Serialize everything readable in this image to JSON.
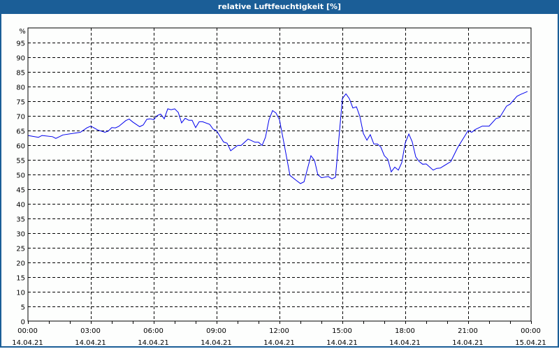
{
  "window": {
    "title": "relative Luftfeuchtigkeit [%]"
  },
  "colors": {
    "titlebar": "#1b5e97",
    "line": "#0000ee",
    "grid": "#000000"
  },
  "chart_data": {
    "type": "line",
    "title": "relative Luftfeuchtigkeit [%]",
    "ylabel": "%",
    "xlabel": "",
    "ylim": [
      0,
      100
    ],
    "xlim_hours": [
      0,
      24
    ],
    "grid": true,
    "y_ticks": [
      "0",
      "5",
      "10",
      "15",
      "20",
      "25",
      "30",
      "35",
      "40",
      "45",
      "50",
      "55",
      "60",
      "65",
      "70",
      "75",
      "80",
      "85",
      "90",
      "95"
    ],
    "x_ticks": [
      {
        "time": "00:00",
        "date": "14.04.21"
      },
      {
        "time": "03:00",
        "date": "14.04.21"
      },
      {
        "time": "06:00",
        "date": "14.04.21"
      },
      {
        "time": "09:00",
        "date": "14.04.21"
      },
      {
        "time": "12:00",
        "date": "14.04.21"
      },
      {
        "time": "15:00",
        "date": "14.04.21"
      },
      {
        "time": "18:00",
        "date": "14.04.21"
      },
      {
        "time": "21:00",
        "date": "14.04.21"
      },
      {
        "time": "00:00",
        "date": "15.04.21"
      }
    ],
    "series": [
      {
        "name": "relative Luftfeuchtigkeit",
        "x_hours": [
          0,
          0.5,
          0.67,
          1.17,
          1.33,
          1.67,
          2.5,
          2.83,
          3.0,
          3.33,
          3.67,
          3.83,
          4.0,
          4.17,
          4.33,
          4.67,
          4.83,
          5.0,
          5.33,
          5.5,
          5.67,
          5.83,
          6.0,
          6.17,
          6.33,
          6.5,
          6.67,
          6.83,
          7.0,
          7.17,
          7.33,
          7.5,
          7.67,
          7.83,
          8.0,
          8.17,
          8.33,
          8.67,
          8.83,
          9.0,
          9.33,
          9.5,
          9.67,
          10.0,
          10.17,
          10.5,
          10.83,
          11.0,
          11.17,
          11.33,
          11.5,
          11.67,
          11.83,
          12.0,
          12.22,
          12.5,
          12.78,
          13.0,
          13.17,
          13.5,
          13.67,
          13.83,
          14.0,
          14.33,
          14.5,
          14.67,
          14.83,
          15.0,
          15.17,
          15.33,
          15.5,
          15.67,
          15.83,
          16.0,
          16.17,
          16.33,
          16.5,
          16.67,
          16.83,
          17.0,
          17.17,
          17.33,
          17.5,
          17.67,
          17.83,
          18.0,
          18.17,
          18.33,
          18.5,
          18.67,
          18.83,
          19.0,
          19.33,
          19.5,
          19.67,
          20.17,
          20.5,
          21.0,
          21.17,
          21.33,
          21.67,
          22.0,
          22.33,
          22.5,
          22.83,
          23.0,
          23.33,
          23.5,
          23.83
        ],
        "values": [
          63.3,
          62.7,
          63.3,
          62.9,
          62.3,
          63.5,
          64.4,
          66.0,
          66.5,
          65.2,
          64.4,
          64.8,
          66.0,
          65.9,
          66.4,
          68.4,
          68.9,
          67.9,
          66.3,
          66.9,
          68.8,
          69.0,
          68.7,
          70.1,
          70.6,
          69.0,
          72.4,
          72.1,
          72.4,
          71.2,
          67.6,
          69.2,
          68.5,
          68.5,
          66.0,
          68.0,
          68.0,
          67.1,
          65.5,
          64.9,
          61.1,
          60.7,
          58.1,
          59.9,
          59.9,
          62.1,
          61.0,
          61.0,
          59.9,
          62.7,
          68.7,
          71.8,
          71.0,
          68.7,
          60.4,
          49.7,
          48.1,
          46.9,
          47.5,
          56.4,
          54.8,
          49.9,
          48.9,
          49.3,
          48.5,
          49.1,
          62.0,
          75.9,
          77.5,
          75.9,
          72.7,
          73.1,
          69.9,
          64.0,
          61.7,
          63.6,
          60.4,
          60.4,
          59.4,
          56.4,
          55.2,
          50.9,
          52.5,
          51.5,
          54.0,
          60.8,
          63.8,
          61.2,
          56.0,
          54.4,
          53.5,
          53.6,
          51.5,
          52.1,
          52.2,
          54.4,
          59.2,
          65.0,
          64.4,
          65.3,
          66.5,
          66.5,
          69.1,
          69.4,
          73.3,
          74.0,
          76.7,
          77.3,
          78.3
        ]
      }
    ]
  }
}
